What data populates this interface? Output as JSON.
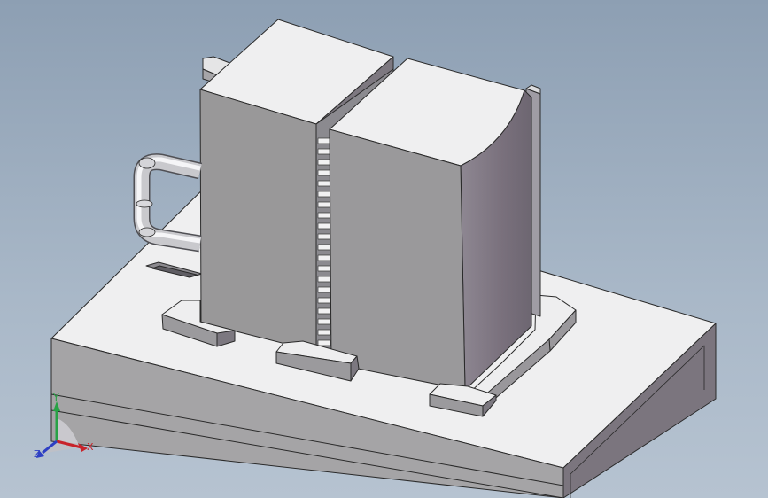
{
  "viewport": {
    "background_top": "#8d9fb3",
    "background_bottom": "#b6c3d1"
  },
  "model": {
    "parts": [
      "base-plate",
      "rear-block",
      "front-block",
      "slotted-separator",
      "bent-pipe",
      "mounting-tabs",
      "frame-ring"
    ],
    "face_colors": {
      "top": "#eeeeef",
      "front": "#999899",
      "side": "#7f7a82",
      "edge": "#2a2a2a"
    }
  },
  "triad": {
    "x_label": "X",
    "y_label": "Y",
    "z_label": "Z",
    "x_color": "#c8232a",
    "y_color": "#27a245",
    "z_color": "#2d3fc4"
  }
}
